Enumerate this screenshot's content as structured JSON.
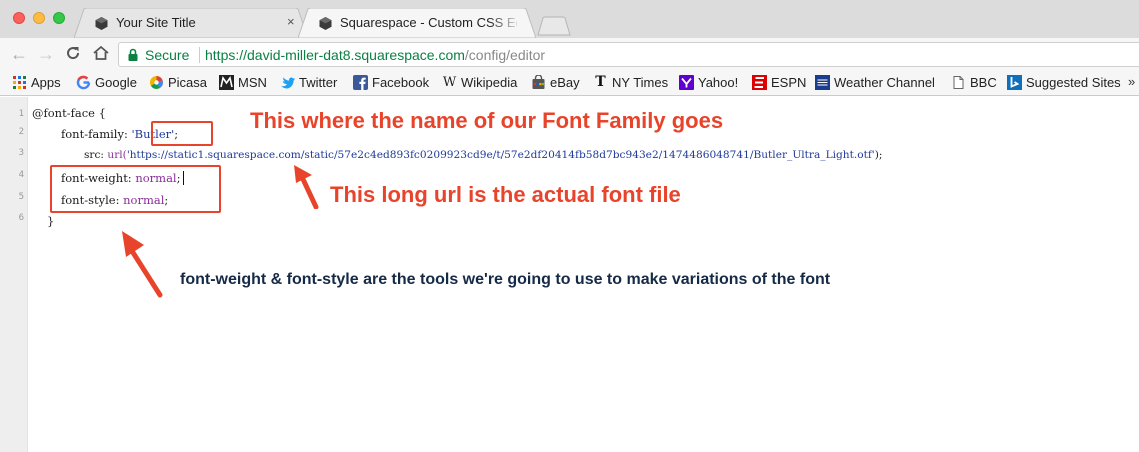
{
  "tabs": [
    {
      "title": "Your Site Title",
      "close_symbol": "×",
      "icon": "squarespace-logo-icon",
      "active": false
    },
    {
      "title": "Squarespace - Custom CSS Ed",
      "icon": "squarespace-logo-icon",
      "active": true
    }
  ],
  "address_bar": {
    "secure_label": "Secure",
    "url_origin": "https://david-miller-dat8.squarespace.com",
    "url_path": "/config/editor"
  },
  "bookmarks": [
    {
      "label": "Apps",
      "icon": "apps-grid-icon"
    },
    {
      "label": "Google",
      "icon": "google-icon"
    },
    {
      "label": "Picasa",
      "icon": "picasa-icon"
    },
    {
      "label": "MSN",
      "icon": "msn-icon"
    },
    {
      "label": "Twitter",
      "icon": "twitter-icon"
    },
    {
      "label": "Facebook",
      "icon": "facebook-icon"
    },
    {
      "label": "Wikipedia",
      "icon": "wikipedia-icon"
    },
    {
      "label": "eBay",
      "icon": "ebay-icon"
    },
    {
      "label": "NY Times",
      "icon": "nytimes-icon"
    },
    {
      "label": "Yahoo!",
      "icon": "yahoo-icon"
    },
    {
      "label": "ESPN",
      "icon": "espn-icon"
    },
    {
      "label": "Weather Channel",
      "icon": "weather-channel-icon"
    },
    {
      "label": "BBC",
      "icon": "page-icon"
    },
    {
      "label": "Suggested Sites",
      "icon": "bing-icon"
    }
  ],
  "editor": {
    "line_numbers": [
      "1",
      "2",
      "3",
      "4",
      "5",
      "6"
    ],
    "lines": {
      "l1": "@font-face {",
      "l2_prop": "font-family:",
      "l2_val": "'Butler'",
      "l2_end": ";",
      "l3_prop": "src:",
      "l3_fn": "url(",
      "l3_val": "'https://static1.squarespace.com/static/57e2c4ed893fc0209923cd9e/t/57e2df20414fb58d7bc943e2/1474486048741/Butler_Ultra_Light.otf'",
      "l3_end": ");",
      "l4_prop": "font-weight:",
      "l4_val": "normal",
      "l4_end": ";",
      "l5_prop": "font-style:",
      "l5_val": "normal",
      "l5_end": ";",
      "l6": "}"
    }
  },
  "annotations": {
    "font_family_note": "This where the name of our Font Family goes",
    "url_note": "This long url is the actual font file",
    "weight_style_note": "font-weight & font-style are the tools we're going to use to make variations of the font"
  },
  "colors": {
    "annotation_red": "#e8442b",
    "annotation_dark": "#152a47",
    "css_string": "#1f3a99",
    "css_keyword": "#8a2f9a",
    "secure_green": "#0b8043"
  }
}
